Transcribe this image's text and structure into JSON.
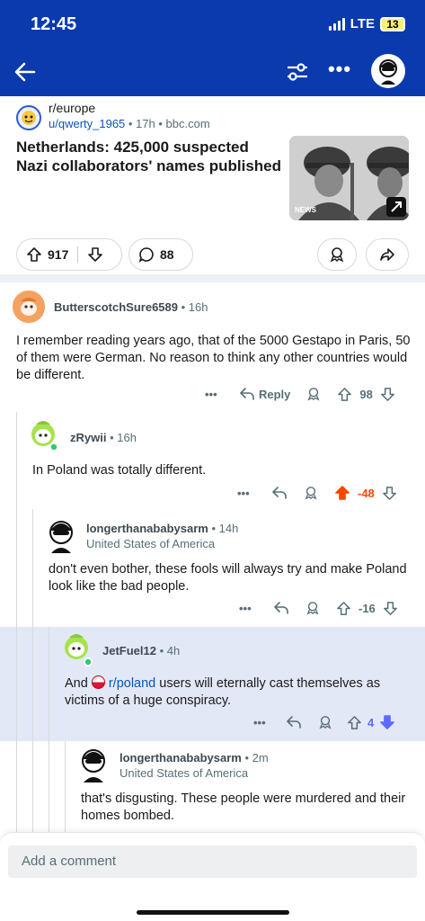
{
  "status_bar": {
    "time": "12:45",
    "network": "LTE",
    "battery": "13"
  },
  "colors": {
    "brand": "#0a3aad",
    "link": "#0a55b7",
    "upvote": "#ff4500",
    "downvote": "#5a6bff",
    "highlight": "#e3e8f6"
  },
  "icons": [
    "back-arrow-icon",
    "filter-icon",
    "more-icon",
    "avatar",
    "upvote-icon",
    "downvote-icon",
    "comment-icon",
    "award-icon",
    "share-icon",
    "external-link-icon"
  ],
  "post": {
    "subreddit": "r/europe",
    "author": "u/qwerty_1965",
    "meta_rest": " • 17h • bbc.com",
    "title": "Netherlands: 425,000 suspected Nazi collaborators' names published",
    "thumbnail_watermark": "NEWS",
    "votes": "917",
    "comments": "88"
  },
  "comments": [
    {
      "user": "ButterscotchSure6589",
      "age": " • 16h",
      "body": "I remember reading years ago, that of the 5000 Gestapo in Paris, 50 of them were German. No reason to think any other countries would be different.",
      "reply_label": "Reply",
      "score": "98"
    },
    {
      "user": "zRywii",
      "age": " • 16h",
      "body": "In Poland was totally different.",
      "score": "-48"
    },
    {
      "user": "longerthanababysarm",
      "age": " • 14h",
      "flair": "United States of America",
      "body": "don't even bother, these fools will always try and make Poland look like the bad people.",
      "score": "-16"
    },
    {
      "user": "JetFuel12",
      "age": " • 4h",
      "body_pre": "And ",
      "sublink": "r/poland",
      "body_post": " users will eternally cast themselves as victims of a huge conspiracy.",
      "score": "4"
    },
    {
      "user": "longerthanababysarm",
      "age": " • 2m",
      "flair": "United States of America",
      "body": "that's disgusting. These people were murdered and their homes bombed."
    }
  ],
  "composer": {
    "placeholder": "Add a comment"
  }
}
